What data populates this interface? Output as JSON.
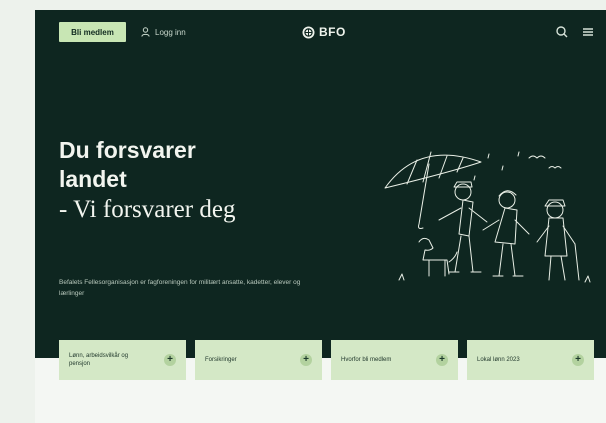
{
  "header": {
    "join_label": "Bli medlem",
    "login_label": "Logg inn",
    "logo_text": "BFO"
  },
  "hero": {
    "line1": "Du forsvarer",
    "line2": "landet",
    "line3": "- Vi forsvarer deg",
    "intro": "Befalets Fellesorganisasjon er fagforeningen for militært ansatte, kadetter, elever og lærlinger"
  },
  "cards": [
    {
      "label": "Lønn, arbeidsvilkår og pensjon"
    },
    {
      "label": "Forsikringer"
    },
    {
      "label": "Hvorfor bli medlem"
    },
    {
      "label": "Lokal lønn 2023"
    }
  ],
  "icons": {
    "user": "user-icon",
    "logo": "bfo-emblem-icon",
    "search": "search-icon",
    "menu": "menu-icon",
    "plus": "plus-icon"
  },
  "colors": {
    "hero_bg": "#0e2620",
    "accent": "#c8e6b4",
    "card_bg": "#d4e8c6",
    "page_bg": "#f4f7f3"
  }
}
